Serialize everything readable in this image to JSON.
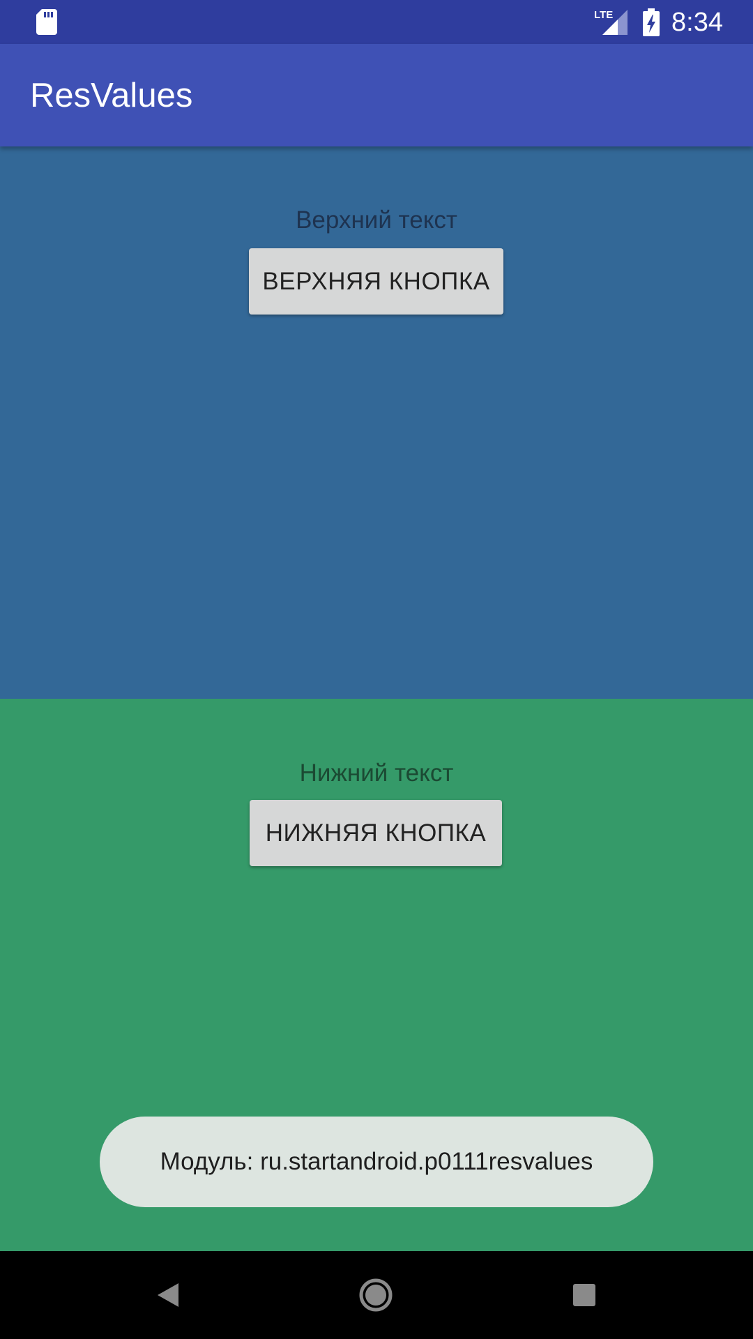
{
  "status_bar": {
    "time": "8:34",
    "network_label": "LTE",
    "icons": [
      "sd-card-icon",
      "lte-signal-icon",
      "battery-charging-icon"
    ]
  },
  "app_bar": {
    "title": "ResValues",
    "color": "#3f51b5"
  },
  "top_panel": {
    "background": "#336897",
    "text": "Верхний текст",
    "button_label": "ВЕРХНЯЯ КНОПКА"
  },
  "bottom_panel": {
    "background": "#359a69",
    "text": "Нижний текст",
    "button_label": "НИЖНЯЯ КНОПКА"
  },
  "toast": {
    "message": "Модуль: ru.startandroid.p0111resvalues"
  },
  "nav_bar": {
    "icons": [
      "back-icon",
      "home-icon",
      "recents-icon"
    ]
  }
}
